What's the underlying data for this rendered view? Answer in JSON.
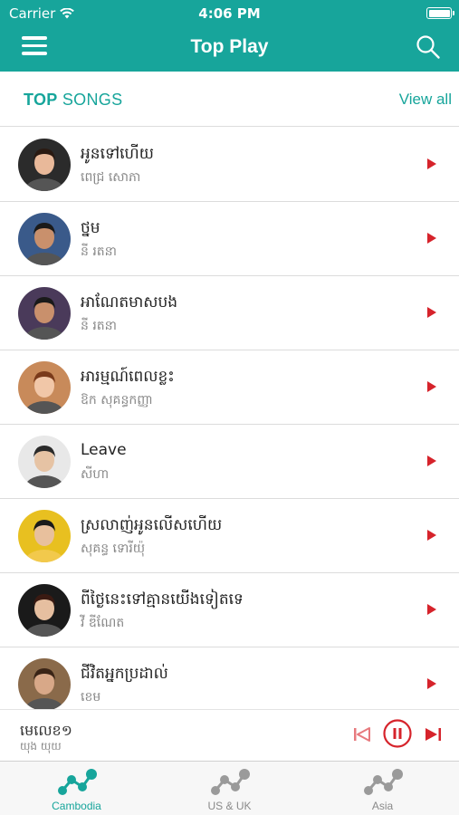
{
  "status_bar": {
    "carrier": "Carrier",
    "time": "4:06 PM"
  },
  "nav": {
    "title": "Top Play",
    "menu_icon": "hamburger-menu-icon",
    "search_icon": "search-icon"
  },
  "section": {
    "title_strong": "TOP",
    "title_rest": " SONGS",
    "view_all": "View all"
  },
  "songs": [
    {
      "title": "អូនទៅហើយ",
      "artist": "ពេជ្រ សោភា",
      "avatar_color": "#2b2b2b"
    },
    {
      "title": "ថ្នម",
      "artist": "នី រតនា",
      "avatar_color": "#3a5a8a"
    },
    {
      "title": "អាណែតមាសបង",
      "artist": "នី រតនា",
      "avatar_color": "#4a3a5a"
    },
    {
      "title": "អារម្មណ៍ពេលខ្លះ",
      "artist": "ឱក សុគន្ធកញ្ញា",
      "avatar_color": "#c88a5a"
    },
    {
      "title": "Leave",
      "artist": "សីហា",
      "avatar_color": "#e8e8e8"
    },
    {
      "title": "ស្រលាញ់អូនលើសហើយ",
      "artist": "សុគន្ធ ទោរីយ៉ុ",
      "avatar_color": "#e8c020"
    },
    {
      "title": "ពីថ្ងៃនេះទៅគ្មានយើងទៀតទេ",
      "artist": "វី ឌីណែត",
      "avatar_color": "#1a1a1a"
    },
    {
      "title": "ជីវិតអ្នកប្រដាល់",
      "artist": "ខេម",
      "avatar_color": "#8a6a4a"
    }
  ],
  "player": {
    "title": "មេលេខ១",
    "artist": "យុង យុយ",
    "prev_icon": "skip-previous-icon",
    "pause_icon": "pause-icon",
    "next_icon": "skip-next-icon"
  },
  "tabs": [
    {
      "label": "Cambodia",
      "active": true
    },
    {
      "label": "US & UK",
      "active": false
    },
    {
      "label": "Asia",
      "active": false
    }
  ],
  "colors": {
    "accent": "#17a59b",
    "play": "#d6232b",
    "inactive": "#8a8a8a"
  }
}
